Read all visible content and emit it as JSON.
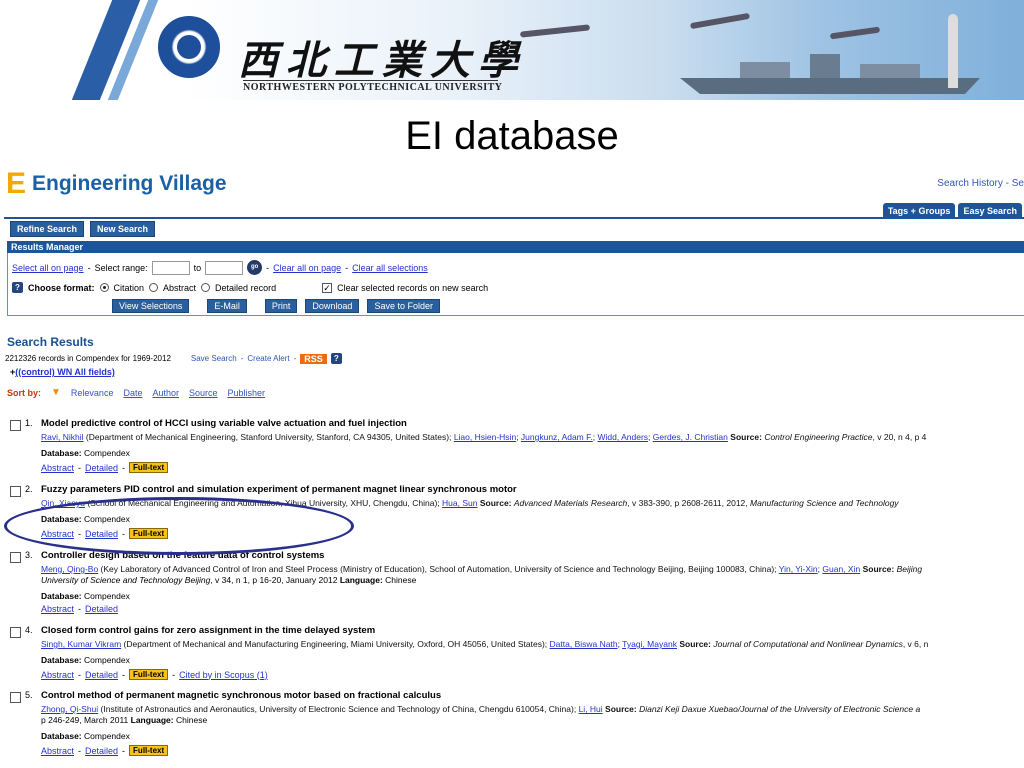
{
  "banner": {
    "cn_name": "西北工業大學",
    "en_name": "NORTHWESTERN POLYTECHNICAL UNIVERSITY"
  },
  "slide_title": "EI database",
  "ev": {
    "logo_mark": "E",
    "name": "Engineering Village",
    "toplinks": "Search History - Se",
    "tabs": [
      "Tags + Groups",
      "Easy Search"
    ],
    "refine_search": "Refine Search",
    "new_search": "New Search"
  },
  "results_manager": {
    "title": "Results Manager",
    "select_all": "Select all on page",
    "select_range": "Select range:",
    "to": "to",
    "go": "go",
    "clear_all": "Clear all on page",
    "clear_selections": "Clear all selections",
    "choose_format": "Choose format:",
    "format_citation": "Citation",
    "format_abstract": "Abstract",
    "format_detailed": "Detailed record",
    "clear_on_new": "Clear selected records on new search",
    "actions": [
      "View Selections",
      "E-Mail",
      "Print",
      "Download",
      "Save to Folder"
    ]
  },
  "search": {
    "title": "Search Results",
    "count": "2212326 records in Compendex for 1969-2012",
    "save_search": "Save Search",
    "create_alert": "Create Alert",
    "rss": "RSS",
    "query": "((control) WN All fields)",
    "sort_by": "Sort by:",
    "sort_options": [
      "Relevance",
      "Date",
      "Author",
      "Source",
      "Publisher"
    ]
  },
  "records": [
    {
      "num": "1.",
      "title": "Model predictive control of HCCI using variable valve actuation and fuel injection",
      "first_author": "Ravi, Nikhil",
      "affil": "(Department of Mechanical Engineering, Stanford University, Stanford, CA 94305, United States);",
      "other_authors": [
        "Liao, Hsien-Hsin",
        "Jungkunz, Adam F.",
        "Widd, Anders",
        "Gerdes, J. Christian"
      ],
      "source_label": "Source:",
      "source": "Control Engineering Practice",
      "source_rest": ", v 20, n 4, p 4",
      "database": "Database:",
      "db_name": "Compendex",
      "abstract": "Abstract",
      "detailed": "Detailed",
      "fulltext": "Full-text"
    },
    {
      "num": "2.",
      "title": "Fuzzy parameters PID control and simulation experiment of permanent magnet linear synchronous motor",
      "first_author": "Qin, Xiaoyu",
      "affil": "(School of Mechanical Engineering and Automation, Xihua University, XHU, Chengdu, China);",
      "other_authors": [
        "Hua, Sun"
      ],
      "source_label": "Source:",
      "source": "Advanced Materials Research",
      "source_rest": ", v 383-390, p 2608-2611, 2012,",
      "source_tail": "Manufacturing Science and Technology",
      "database": "Database:",
      "db_name": "Compendex",
      "abstract": "Abstract",
      "detailed": "Detailed",
      "fulltext": "Full-text"
    },
    {
      "num": "3.",
      "title": "Controller design based on the feature data of control systems",
      "first_author": "Meng, Qing-Bo",
      "affil": "(Key Laboratory of Advanced Control of Iron and Steel Process (Ministry of Education), School of Automation, University of Science and Technology Beijing, Beijing 100083, China);",
      "other_authors": [
        "Yin, Yi-Xin",
        "Guan, Xin"
      ],
      "source_label": "Source:",
      "source": "Beijing",
      "line2_source": "University of Science and Technology Beijing",
      "line2_rest": ", v 34, n 1, p 16-20, January 2012",
      "language_label": "Language:",
      "language": "Chinese",
      "database": "Database:",
      "db_name": "Compendex",
      "abstract": "Abstract",
      "detailed": "Detailed"
    },
    {
      "num": "4.",
      "title": "Closed form control gains for zero assignment in the time delayed system",
      "first_author": "Singh, Kumar Vikram",
      "affil": "(Department of Mechanical and Manufacturing Engineering, Miami University, Oxford, OH 45056, United States);",
      "other_authors": [
        "Datta, Biswa Nath",
        "Tyagi, Mayank"
      ],
      "source_label": "Source:",
      "source": "Journal of Computational and Nonlinear Dynamics",
      "source_rest": ", v 6, n",
      "database": "Database:",
      "db_name": "Compendex",
      "abstract": "Abstract",
      "detailed": "Detailed",
      "fulltext": "Full-text",
      "cited": "Cited by in Scopus (1)"
    },
    {
      "num": "5.",
      "title": "Control method of permanent magnetic synchronous motor based on fractional calculus",
      "first_author": "Zhong, Qi-Shui",
      "affil": "(Institute of Astronautics and Aeronautics, University of Electronic Science and Technology of China, Chengdu 610054, China);",
      "other_authors": [
        "Li, Hui"
      ],
      "source_label": "Source:",
      "source": "Dianzi Keji Daxue Xuebao/Journal of the University of Electronic Science a",
      "line2_rest": "p 246-249, March 2011",
      "language_label": "Language:",
      "language": "Chinese",
      "database": "Database:",
      "db_name": "Compendex",
      "abstract": "Abstract",
      "detailed": "Detailed",
      "fulltext": "Full-text"
    }
  ]
}
